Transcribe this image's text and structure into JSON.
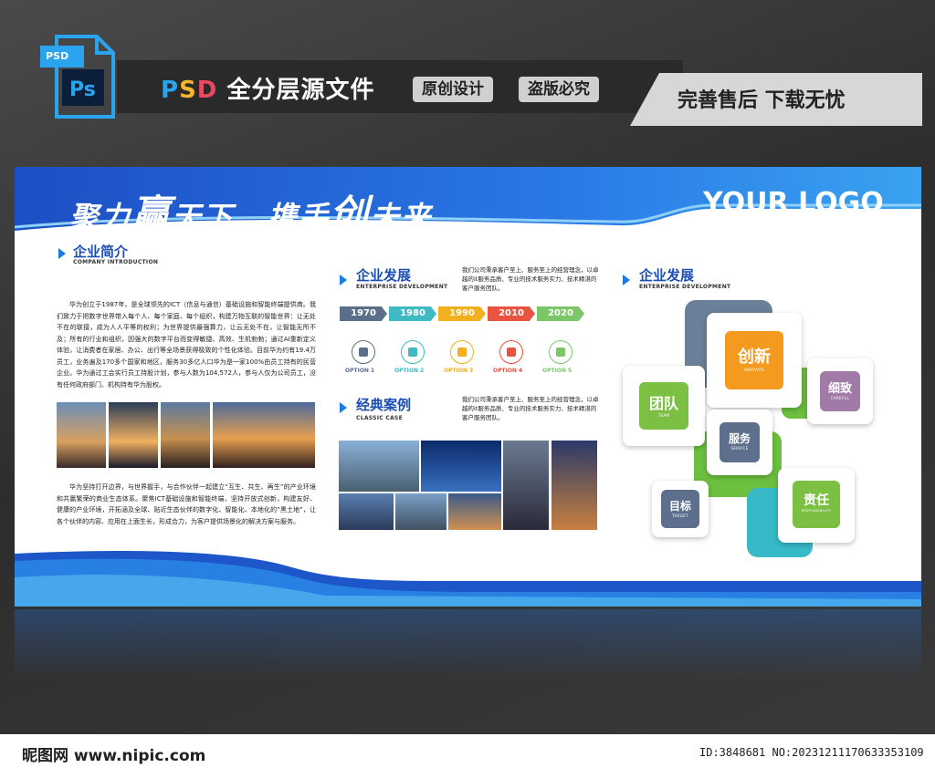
{
  "header": {
    "psd_badge": "PSD",
    "ps_label": "Ps",
    "title_psd": [
      "P",
      "S",
      "D"
    ],
    "title_rest": "全分层源文件",
    "pill_1": "原创设计",
    "pill_2": "盗版必究",
    "slogan_right": "完善售后 下载无忧"
  },
  "board": {
    "slogan_a": "聚力",
    "slogan_b": "赢",
    "slogan_c": "天下",
    "slogan_d": "携手",
    "slogan_e": "创",
    "slogan_f": "未来",
    "logo": "YOUR LOGO",
    "intro": {
      "title": "企业简介",
      "subtitle": "COMPANY INTRODUCTION",
      "para1": "华为创立于1987年，是全球领先的ICT（信息与通信）基础设施和智能终端提供商。我们致力于把数字世界带入每个人、每个家庭、每个组织，构建万物互联的智能世界：让无处不在的联接，成为人人平等的权利；为世界提供最强算力，让云无处不在，让智能无所不及；所有的行业和组织，因强大的数字平台而变得敏捷、高效、生机勃勃；通过AI重新定义体验，让消费者在家居、办公、出行等全场景获得极致的个性化体验。目前华为约有19.4万员工，业务遍及170多个国家和地区，服务30多亿人口华为是一家100%由员工持有的民营企业。华为通过工会实行员工持股计划，参与人数为104,572人，参与人仅为公司员工，没有任何政府部门、机构持有华为股权。",
      "para2": "华为坚持打开边界，与世界握手，与合作伙伴一起建立“互生、共生、再生”的产业环境和共赢繁荣的商业生态体系。聚焦ICT基础设施和智能终端，坚持开放式创新，构建友好、健康的产业环境，开拓涵及全球、贴近生态伙伴的数字化、智能化、本地化的“黑土地”，让各个伙伴的内容、应用在上面生长，形成合力，为客户提供场景化的解决方案与服务。"
    },
    "development": {
      "title": "企业发展",
      "subtitle": "ENTERPRISE DEVELOPMENT",
      "text": "我们公司秉承客户至上、服务至上的经营理念，以卓越的it服务品质、专业的技术服务实力、技术精湛的客户服务团队。",
      "years": [
        "1970",
        "1980",
        "1990",
        "2010",
        "2020"
      ],
      "options": [
        "OPTION 1",
        "OPTION 2",
        "OPTION 3",
        "OPTION 4",
        "OPTION 5"
      ],
      "colors": [
        "#5b6f8a",
        "#3fb9c2",
        "#f2b01e",
        "#e8543f",
        "#7cc66a"
      ]
    },
    "cases": {
      "title": "经典案例",
      "subtitle": "CLASSIC CASE",
      "text": "我们公司秉承客户至上、服务至上的经营理念，以卓越的it服务品质、专业的技术服务实力、技术精湛的客户服务团队。"
    },
    "values": {
      "title": "企业发展",
      "subtitle": "ENTERPRISE DEVELOPMENT",
      "innovate": {
        "cn": "创新",
        "en": "INNOVATE"
      },
      "team": {
        "cn": "团队",
        "en": "TEAM"
      },
      "careful": {
        "cn": "细致",
        "en": "CAREFUL"
      },
      "service": {
        "cn": "服务",
        "en": "SERVICE"
      },
      "target": {
        "cn": "目标",
        "en": "TARGET"
      },
      "responsibility": {
        "cn": "责任",
        "en": "RESPONSIBILITY"
      }
    }
  },
  "footer": {
    "left": "昵图网 www.nipic.com",
    "right": "ID:3848681 NO:20231211170633353109"
  }
}
